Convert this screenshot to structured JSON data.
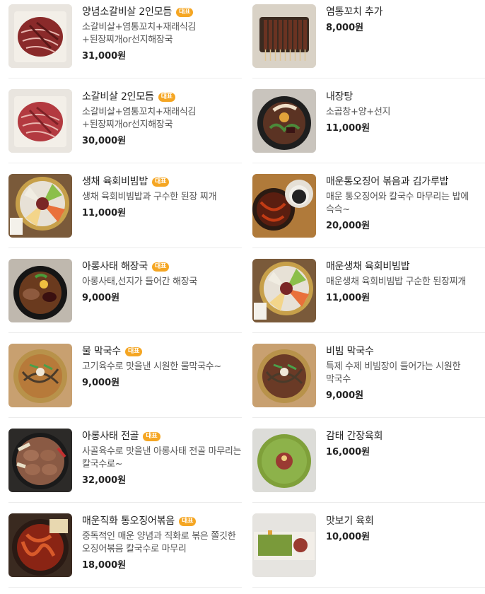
{
  "badge_color": "#f5a623",
  "left_items": [
    {
      "name": "양념소갈비살 2인모듬",
      "badge": "대표",
      "desc": "소갈비살+염통꼬치+재래식김+된장찌개or선지해장국",
      "price": "31,000원",
      "image": "marinated-beef-rib-platter"
    },
    {
      "name": "소갈비살 2인모듬",
      "badge": "대표",
      "desc": "소갈비살+염통꼬치+재래식김+된장찌개or선지해장국",
      "price": "30,000원",
      "image": "beef-rib-platter"
    },
    {
      "name": "생채 육회비빔밥",
      "badge": "대표",
      "desc": "생채 육회비빔밥과 구수한 된장 찌개",
      "price": "11,000원",
      "image": "yukhoe-bibimbap"
    },
    {
      "name": "아롱사태 해장국",
      "badge": "대표",
      "desc": "아롱사태,선지가 들어간 해장국",
      "price": "9,000원",
      "image": "shank-hangover-soup"
    },
    {
      "name": "물 막국수",
      "badge": "대표",
      "desc": "고기육수로 맛을낸 시원한 물막국수~",
      "price": "9,000원",
      "image": "cold-buckwheat-noodles"
    },
    {
      "name": "아롱사태 전골",
      "badge": "대표",
      "desc": "사골육수로 맛을낸 아롱사태 전골 마무리는 칼국수로~",
      "price": "32,000원",
      "image": "shank-hotpot"
    },
    {
      "name": "매운직화 통오징어볶음",
      "badge": "대표",
      "desc": "중독적인 매운 양념과 직화로 볶은 쫄깃한 오징어볶음 칼국수로 마무리",
      "price": "18,000원",
      "image": "spicy-squid-stirfry"
    }
  ],
  "right_items": [
    {
      "name": "염통꼬치 추가",
      "badge": "",
      "desc": "",
      "price": "8,000원",
      "image": "heart-skewers"
    },
    {
      "name": "내장탕",
      "badge": "",
      "desc": "소곱창+양+선지",
      "price": "11,000원",
      "image": "offal-soup"
    },
    {
      "name": "매운통오징어 볶음과 김가루밥",
      "badge": "",
      "desc": "매운 통오징어와 칼국수 마무리는 밥에 슥슥~",
      "price": "20,000원",
      "image": "squid-with-seaweed-rice"
    },
    {
      "name": "매운생채 육회비빔밥",
      "badge": "",
      "desc": "매운생채 육회비빔밥 구순한 된장찌개",
      "price": "11,000원",
      "image": "spicy-yukhoe-bibimbap"
    },
    {
      "name": "비빔 막국수",
      "badge": "",
      "desc": "특제 수제 비빔장이 들어가는 시원한 막국수",
      "price": "9,000원",
      "image": "spicy-buckwheat-noodles"
    },
    {
      "name": "감태 간장육회",
      "badge": "",
      "desc": "",
      "price": "16,000원",
      "image": "seaweed-soy-yukhoe"
    },
    {
      "name": "맛보기 육회",
      "badge": "",
      "desc": "",
      "price": "10,000원",
      "image": "sample-yukhoe"
    }
  ]
}
